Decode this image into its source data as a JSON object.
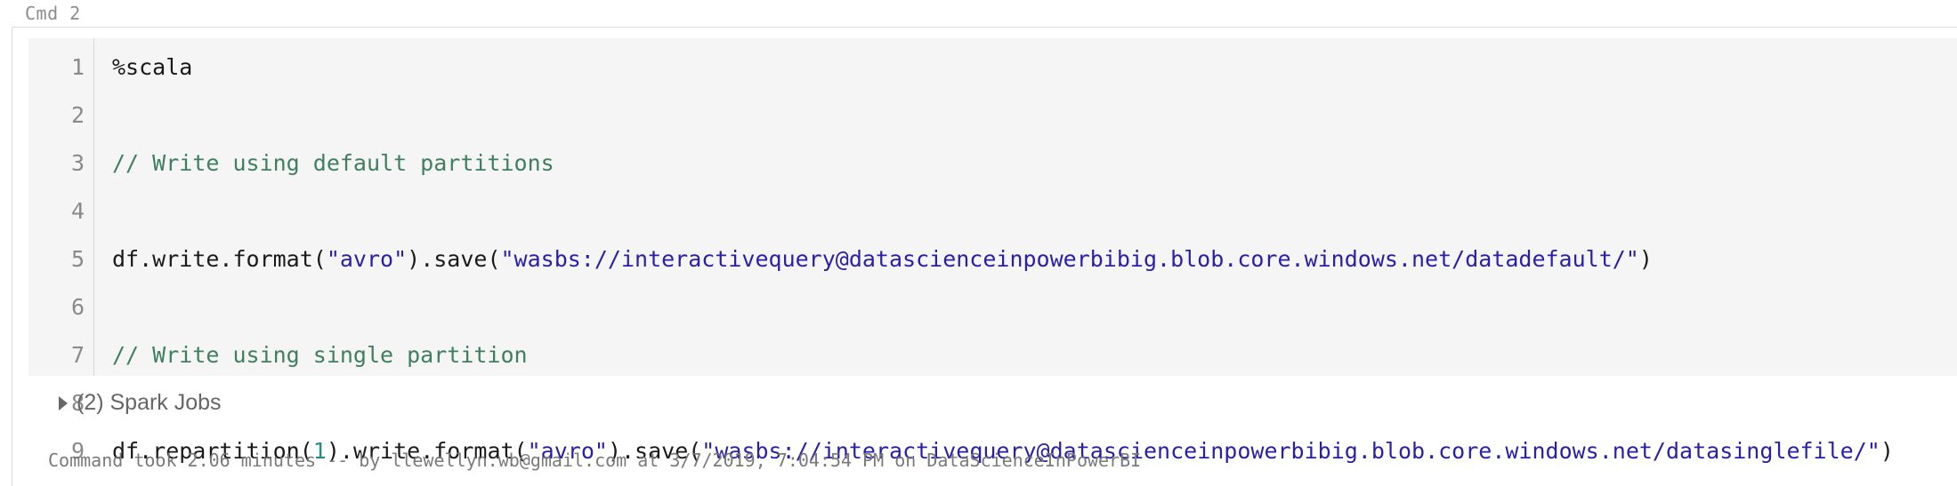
{
  "cell": {
    "cmd_label": "Cmd 2",
    "lines": [
      {
        "num": "1",
        "segments": [
          {
            "text": "%scala",
            "kind": "plain"
          }
        ]
      },
      {
        "num": "2",
        "segments": []
      },
      {
        "num": "3",
        "segments": [
          {
            "text": "// Write using default partitions",
            "kind": "comment"
          }
        ]
      },
      {
        "num": "4",
        "segments": []
      },
      {
        "num": "5",
        "segments": [
          {
            "text": "df.write.format(",
            "kind": "plain"
          },
          {
            "text": "\"avro\"",
            "kind": "string"
          },
          {
            "text": ").save(",
            "kind": "plain"
          },
          {
            "text": "\"wasbs://interactivequery@datascienceinpowerbibig.blob.core.windows.net/datadefault/\"",
            "kind": "string"
          },
          {
            "text": ")",
            "kind": "plain"
          }
        ]
      },
      {
        "num": "6",
        "segments": []
      },
      {
        "num": "7",
        "segments": [
          {
            "text": "// Write using single partition",
            "kind": "comment"
          }
        ]
      },
      {
        "num": "8",
        "segments": []
      },
      {
        "num": "9",
        "segments": [
          {
            "text": "df.repartition(",
            "kind": "plain"
          },
          {
            "text": "1",
            "kind": "number"
          },
          {
            "text": ").write.format(",
            "kind": "plain"
          },
          {
            "text": "\"avro\"",
            "kind": "string"
          },
          {
            "text": ").save(",
            "kind": "plain"
          },
          {
            "text": "\"wasbs://interactivequery@datascienceinpowerbibig.blob.core.windows.net/datasinglefile/\"",
            "kind": "string"
          },
          {
            "text": ")",
            "kind": "plain"
          }
        ]
      }
    ],
    "spark_jobs_label": "(2) Spark Jobs",
    "status_text": "Command took 2.06 minutes -- by llewellyn.wb@gmail.com at 3/7/2019, 7:04:54 PM on DataScienceInPowerBI"
  },
  "colors": {
    "comment": "#3f7f5f",
    "string": "#2a1fa8",
    "number": "#2a8a8a",
    "editor_bg": "#f5f5f5"
  },
  "icons": {
    "jobs_toggle": "triangle-right-icon"
  }
}
